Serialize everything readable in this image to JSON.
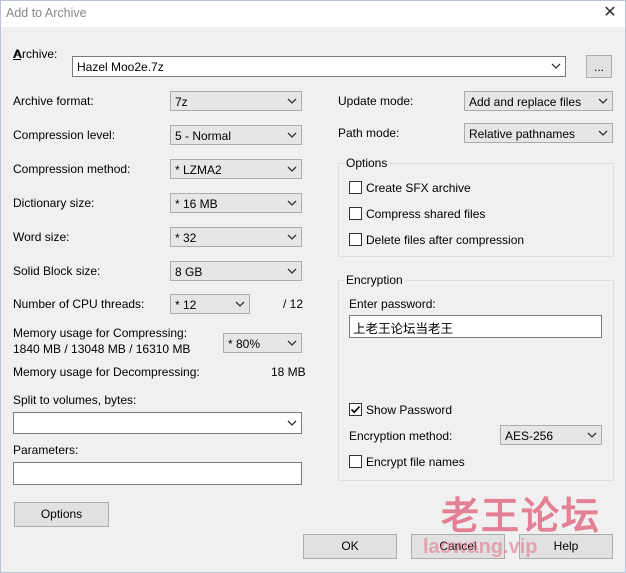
{
  "window": {
    "title": "Add to Archive",
    "close_glyph": "✕"
  },
  "archive": {
    "label": "Archive:",
    "value": "Hazel Moo2e.7z",
    "browse_label": "..."
  },
  "left": {
    "archive_format": {
      "label": "Archive format:",
      "value": "7z"
    },
    "compression_level": {
      "label": "Compression level:",
      "value": "5 - Normal"
    },
    "compression_method": {
      "label": "Compression method:",
      "value": "*  LZMA2"
    },
    "dictionary_size": {
      "label": "Dictionary size:",
      "value": "*  16 MB"
    },
    "word_size": {
      "label": "Word size:",
      "value": "*  32"
    },
    "solid_block_size": {
      "label": "Solid Block size:",
      "value": "8 GB"
    },
    "cpu_threads": {
      "label": "Number of CPU threads:",
      "value": "*  12",
      "max": "/ 12"
    },
    "memory_compress": {
      "label": "Memory usage for Compressing:",
      "detail": "1840 MB / 13048 MB / 16310 MB",
      "value": "* 80%"
    },
    "memory_decompress": {
      "label": "Memory usage for Decompressing:",
      "value": "18 MB"
    },
    "split_volumes": {
      "label": "Split to volumes, bytes:",
      "value": ""
    },
    "parameters": {
      "label": "Parameters:",
      "value": ""
    },
    "options_button": "Options"
  },
  "right": {
    "update_mode": {
      "label": "Update mode:",
      "value": "Add and replace files"
    },
    "path_mode": {
      "label": "Path mode:",
      "value": "Relative pathnames"
    },
    "options_group": {
      "title": "Options",
      "items": [
        {
          "label": "Create SFX archive",
          "checked": false
        },
        {
          "label": "Compress shared files",
          "checked": false
        },
        {
          "label": "Delete files after compression",
          "checked": false
        }
      ]
    },
    "encryption": {
      "title": "Encryption",
      "password_label": "Enter password:",
      "password_value": "上老王论坛当老王",
      "show_password": {
        "label": "Show Password",
        "checked": true
      },
      "method_label": "Encryption method:",
      "method_value": "AES-256",
      "encrypt_names": {
        "label": "Encrypt file names",
        "checked": false
      }
    }
  },
  "buttons": {
    "ok": "OK",
    "cancel": "Cancel",
    "help": "Help"
  },
  "watermark": {
    "line1": "老王论坛",
    "line2": "laowang.vip"
  }
}
